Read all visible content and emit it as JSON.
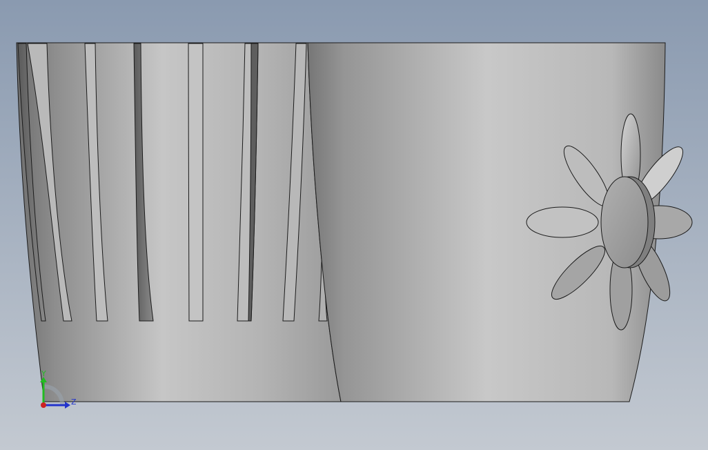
{
  "viewport": {
    "background_top": "#8a9ab0",
    "background_bottom": "#c2c8d0",
    "model_light": "#cfcfcf",
    "model_mid": "#a9a9a9",
    "model_dark": "#6e6e6e",
    "edge_color": "#1a1a1a"
  },
  "triad": {
    "y_label": "Y",
    "z_label": "Z",
    "y_color": "#22bb22",
    "z_color": "#2233cc",
    "origin_color": "#cc2222"
  }
}
